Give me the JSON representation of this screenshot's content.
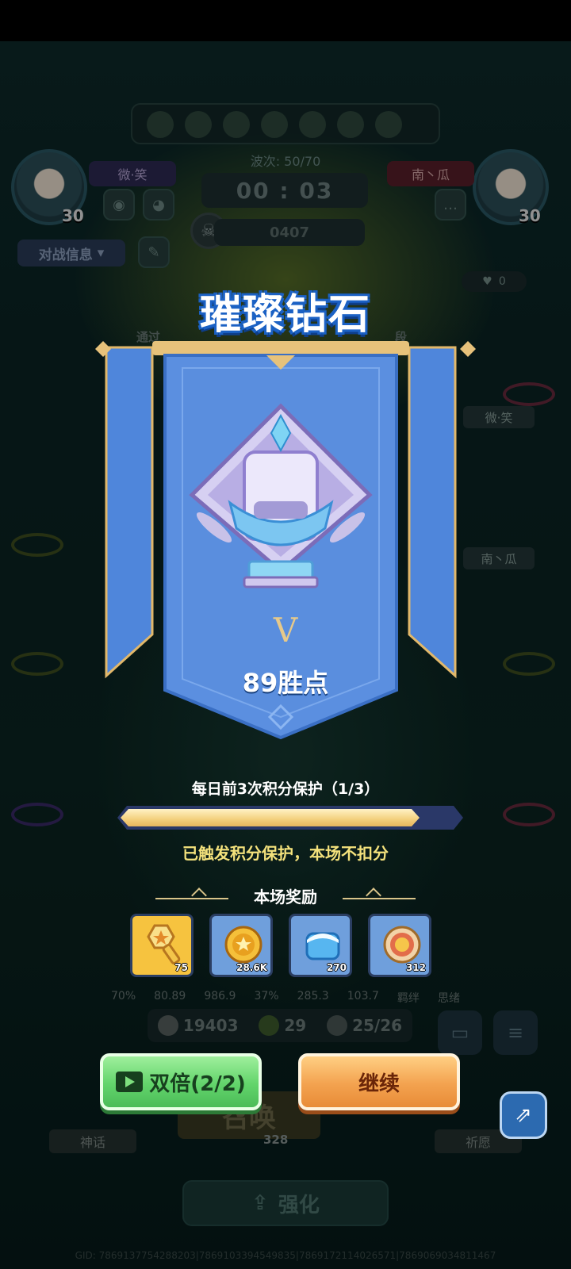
{
  "hud": {
    "wave": "波次: 50/70",
    "timer": "00 : 03",
    "counter": "0407",
    "player_left": {
      "name": "微·笑",
      "level": "30"
    },
    "player_right": {
      "name": "南丶瓜",
      "level": "30"
    },
    "battle_info": "对战信息",
    "likes": "0",
    "side_name_1": "微·笑",
    "side_name_2": "南丶瓜",
    "behind_text_left": "通过",
    "behind_text_right": "段",
    "stats": [
      "70%",
      "80.89",
      "986.9",
      "37%",
      "285.3",
      "103.7",
      "羁绊",
      "思绪"
    ],
    "currency": {
      "coins": "19403",
      "green": "29",
      "units": "25/26"
    },
    "bottom_title": "召唤",
    "bottom_sub": "328",
    "left_bottom_label": "神话",
    "right_bottom_label": "祈愿",
    "upgrade": "强化",
    "gid": "GID: 7869137754288203|7869103394549835|7869172114026571|7869069034811467"
  },
  "modal": {
    "rank_title": "璀璨钻石",
    "tier": "V",
    "points": "89胜点",
    "protection_text": "每日前3次积分保护（1/3）",
    "protection_progress": 0.88,
    "protection_status": "已触发积分保护，本场不扣分",
    "reward_title": "本场奖励",
    "rewards": [
      {
        "icon": "key-icon",
        "count": "75",
        "bg": "#f6c33f"
      },
      {
        "icon": "gold-coin-icon",
        "count": "28.6K",
        "bg": "#6f9fdc"
      },
      {
        "icon": "ice-cube-icon",
        "count": "270",
        "bg": "#6f9fdc"
      },
      {
        "icon": "medal-coin-icon",
        "count": "312",
        "bg": "#6f9fdc"
      }
    ],
    "double_button": "双倍(2/2)",
    "continue_button": "继续"
  },
  "colors": {
    "banner_blue": "#5b8fe0",
    "banner_gold": "#e2b86a",
    "double_green": "#62d46b",
    "continue_orange": "#f3a24f",
    "status_yellow": "#f4e27c"
  }
}
